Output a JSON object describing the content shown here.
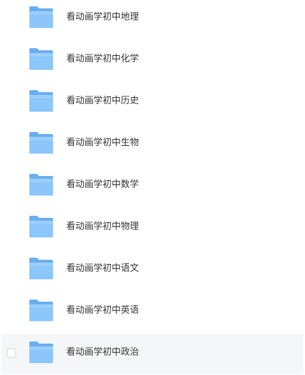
{
  "folders": [
    {
      "name": "看动画学初中地理"
    },
    {
      "name": "看动画学初中化学"
    },
    {
      "name": "看动画学初中历史"
    },
    {
      "name": "看动画学初中生物"
    },
    {
      "name": "看动画学初中数学"
    },
    {
      "name": "看动画学初中物理"
    },
    {
      "name": "看动画学初中语文"
    },
    {
      "name": "看动画学初中英语"
    },
    {
      "name": "看动画学初中政治"
    }
  ],
  "icons": {
    "folder": "folder-icon",
    "checkbox": "checkbox-unchecked"
  },
  "colors": {
    "folder_back": "#6aaef0",
    "folder_front": "#8cc6fa",
    "folder_front_light": "#a9d6fd",
    "hover_background": "#f5f6f8",
    "text": "#333333"
  }
}
